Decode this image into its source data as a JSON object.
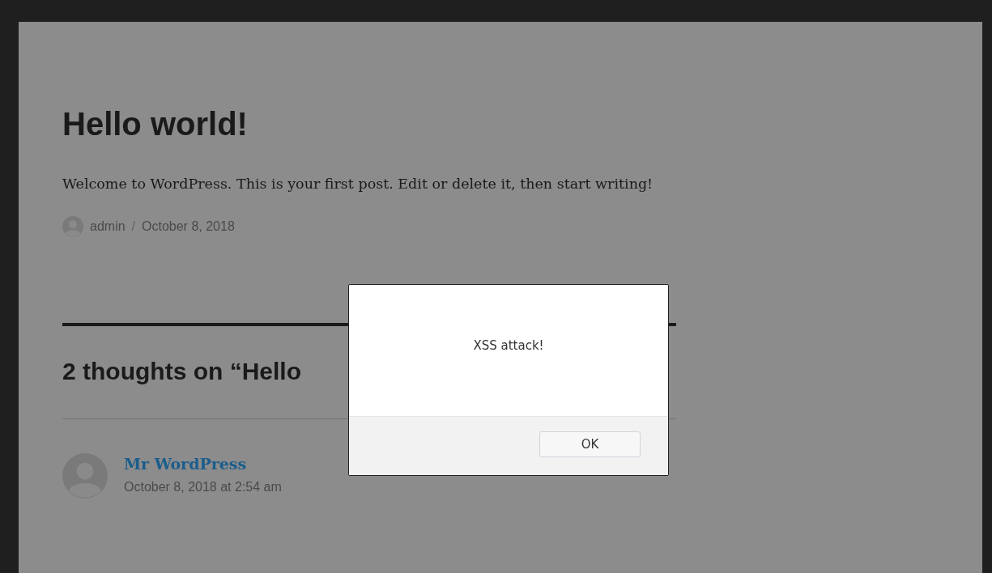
{
  "post": {
    "title": "Hello world!",
    "body": "Welcome to WordPress. This is your first post. Edit or delete it, then start writing!",
    "author": "admin",
    "separator": "/",
    "date": "October 8, 2018"
  },
  "comments": {
    "heading": "2 thoughts on “Hello",
    "items": [
      {
        "author": "Mr WordPress",
        "date": "October 8, 2018 at 2:54 am"
      }
    ]
  },
  "alert": {
    "message": "XSS attack!",
    "buttons": [
      "OK"
    ]
  }
}
